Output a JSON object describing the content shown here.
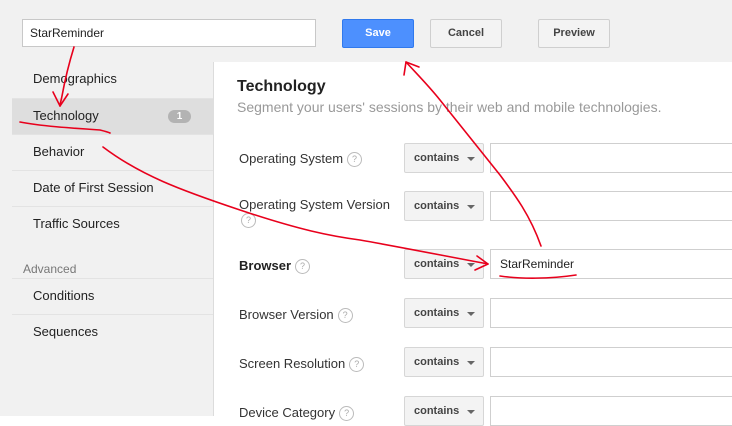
{
  "toolbar": {
    "segment_name": "StarReminder",
    "save_label": "Save",
    "cancel_label": "Cancel",
    "preview_label": "Preview"
  },
  "sidebar": {
    "items": [
      {
        "label": "Demographics"
      },
      {
        "label": "Technology",
        "badge": "1",
        "active": true
      },
      {
        "label": "Behavior"
      },
      {
        "label": "Date of First Session"
      },
      {
        "label": "Traffic Sources"
      }
    ],
    "advanced_heading": "Advanced",
    "advanced_items": [
      {
        "label": "Conditions"
      },
      {
        "label": "Sequences"
      }
    ]
  },
  "main": {
    "title": "Technology",
    "subtitle": "Segment your users' sessions by their web and mobile technologies.",
    "help_glyph": "?",
    "rows": [
      {
        "label": "Operating System",
        "operator": "contains",
        "value": ""
      },
      {
        "label": "Operating System Version",
        "operator": "contains",
        "value": ""
      },
      {
        "label": "Browser",
        "operator": "contains",
        "value": "StarReminder"
      },
      {
        "label": "Browser Version",
        "operator": "contains",
        "value": ""
      },
      {
        "label": "Screen Resolution",
        "operator": "contains",
        "value": ""
      },
      {
        "label": "Device Category",
        "operator": "contains",
        "value": ""
      }
    ]
  },
  "colors": {
    "save_button": "#4d90fe",
    "annotation": "#e8001c",
    "sidebar_bg": "#f1f1f1",
    "active_item_bg": "#dedede"
  }
}
